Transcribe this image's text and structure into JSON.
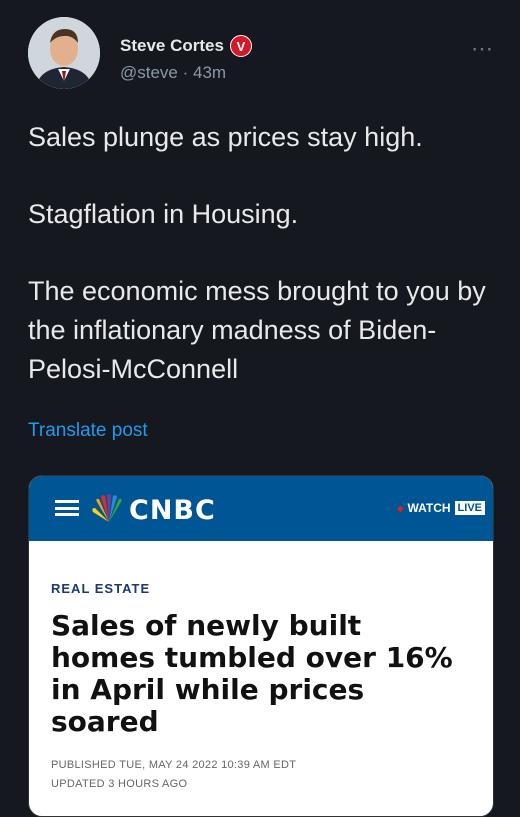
{
  "tweet": {
    "author_name": "Steve Cortes",
    "verified_badge": "V",
    "handle_time": "@steve · 43m",
    "more_icon": "⋯",
    "paragraphs": [
      "Sales plunge as prices stay high.",
      "Stagflation in Housing.",
      "The economic mess brought to you by the inflationary madness of Biden-Pelosi-McConnell"
    ],
    "translate_label": "Translate post"
  },
  "card": {
    "brand": "CNBC",
    "watch_label": "WATCH",
    "live_label": "LIVE",
    "section": "REAL ESTATE",
    "headline": "Sales of newly built homes tumbled over 16% in April while prices soared",
    "published": "PUBLISHED TUE, MAY 24 2022 10:39 AM EDT",
    "updated": "UPDATED 3 HOURS AGO"
  },
  "colors": {
    "background": "#15181f",
    "link": "#1d9bf0",
    "cnbc_blue": "#005594",
    "badge_red": "#d5182a"
  }
}
